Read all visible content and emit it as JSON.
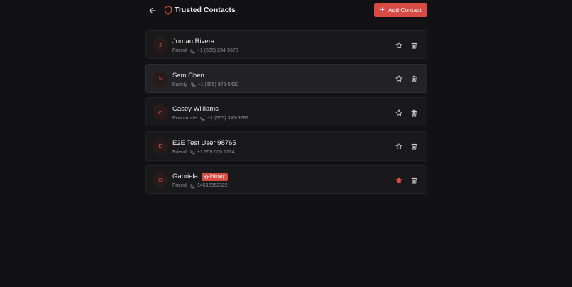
{
  "header": {
    "title": "Trusted Contacts",
    "add_label": "Add Contact",
    "add_icon": "+"
  },
  "colors": {
    "accent": "#d84a44",
    "background": "#121214",
    "card": "#19191c"
  },
  "contacts": [
    {
      "initial": "J",
      "name": "Jordan Rivera",
      "relation": "Friend",
      "phone": "+1 (555) 234-5678",
      "primary": false
    },
    {
      "initial": "S",
      "name": "Sam Chen",
      "relation": "Family",
      "phone": "+1 (555) 876-5432",
      "primary": false
    },
    {
      "initial": "C",
      "name": "Casey Williams",
      "relation": "Roommate",
      "phone": "+1 (555) 345-6789",
      "primary": false
    },
    {
      "initial": "E",
      "name": "E2E Test User 98765",
      "relation": "Friend",
      "phone": "+1 555 000 1234",
      "primary": false
    },
    {
      "initial": "G",
      "name": "Gabriela",
      "relation": "Friend",
      "phone": "14532352322",
      "primary": true,
      "badge": "Primary"
    }
  ]
}
